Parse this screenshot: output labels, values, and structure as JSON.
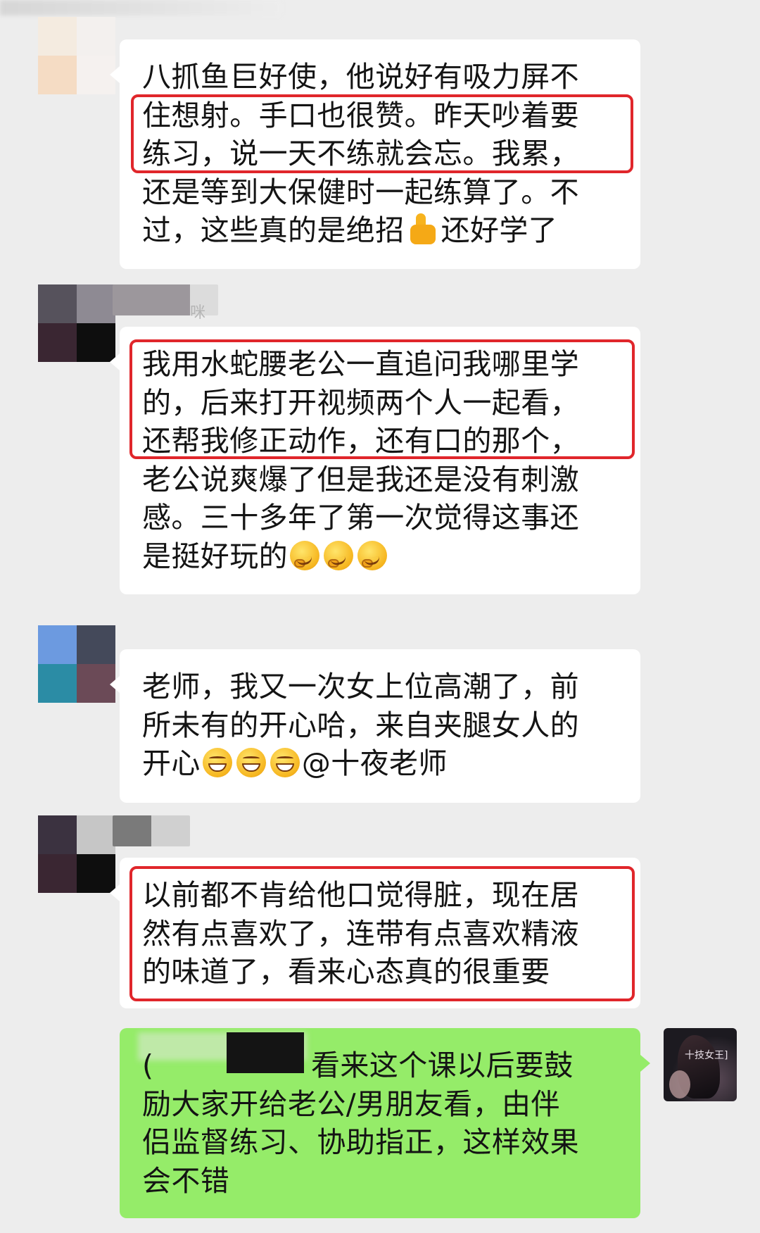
{
  "messages": [
    {
      "text": "八抓鱼巨好使，他说好有吸力屏不\n住想射。手口也很赞。昨天吵着要\n练习，说一天不练就会忘。我累，\n还是等到大保健时一起练算了。不\n过，这些真的是绝招",
      "text_tail": "还好学了",
      "emoji": "thumbs-up-icon"
    },
    {
      "sender_partial": "咪",
      "text": "我用水蛇腰老公一直追问我哪里学\n的，后来打开视频两个人一起看，\n还帮我修正动作，还有口的那个，\n老公说爽爆了但是我还是没有刺激\n感。三十多年了第一次觉得这事还\n是挺好玩的",
      "emoji": "smirk-face-icon"
    },
    {
      "text": "老师，我又一次女上位高潮了，前\n所未有的开心哈，来自夹腿女人的\n开心",
      "text_tail": "@十夜老师",
      "emoji": "grin-face-icon"
    },
    {
      "text": "以前都不肯给他口觉得脏，现在居\n然有点喜欢了，连带有点喜欢精液\n的味道了，看来心态真的很重要"
    },
    {
      "text_line1_tail": "看来这个课以后要鼓",
      "text_rest": "励大家开给老公/男朋友看，由伴\n侣监督练习、协助指正，这样效果\n会不错",
      "prefix_partial": "(",
      "avatar_tag": "十技女王]"
    }
  ],
  "colors": {
    "background": "#ededed",
    "bubble_received": "#ffffff",
    "bubble_sent": "#95ec69",
    "highlight": "#e0262b"
  }
}
